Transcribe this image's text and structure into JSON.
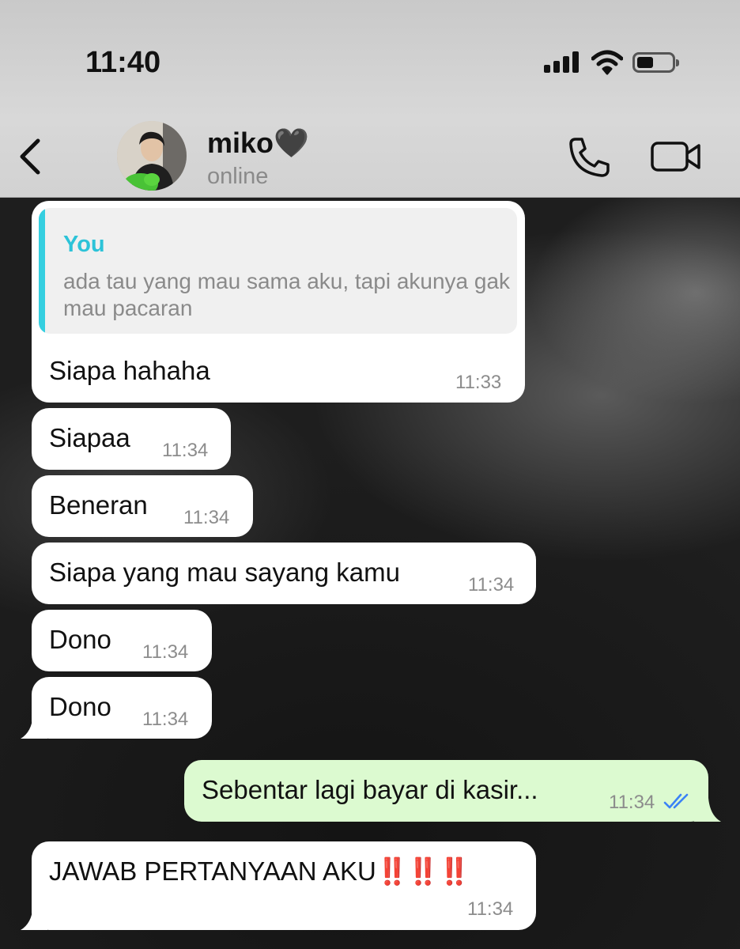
{
  "status_bar": {
    "time": "11:40"
  },
  "header": {
    "contact_name": "miko🖤",
    "contact_status": "online"
  },
  "messages": [
    {
      "direction": "incoming",
      "reply_to": {
        "author": "You",
        "text": "ada tau yang mau sama aku, tapi akunya gak mau pacaran"
      },
      "text": "Siapa hahaha",
      "time": "11:33"
    },
    {
      "direction": "incoming",
      "text": "Siapaa",
      "time": "11:34"
    },
    {
      "direction": "incoming",
      "text": "Beneran",
      "time": "11:34"
    },
    {
      "direction": "incoming",
      "text": "Siapa yang mau sayang kamu",
      "time": "11:34"
    },
    {
      "direction": "incoming",
      "text": "Dono",
      "time": "11:34"
    },
    {
      "direction": "incoming",
      "text": "Dono",
      "time": "11:34"
    },
    {
      "direction": "outgoing",
      "text": "Sebentar lagi bayar di kasir...",
      "time": "11:34",
      "read": true
    },
    {
      "direction": "incoming",
      "text": "JAWAB PERTANYAAN AKU",
      "emphasis": "‼️‼️‼️",
      "time": "11:34"
    }
  ],
  "colors": {
    "outgoing_bubble": "#dcfad0",
    "incoming_bubble": "#ffffff",
    "reply_accent": "#35cfe0",
    "read_ticks": "#3b82f6",
    "emphasis": "#e51d1d"
  },
  "icons": [
    "cellular-signal-icon",
    "wifi-icon",
    "battery-icon",
    "back-chevron-icon",
    "phone-icon",
    "video-camera-icon",
    "double-check-icon"
  ]
}
